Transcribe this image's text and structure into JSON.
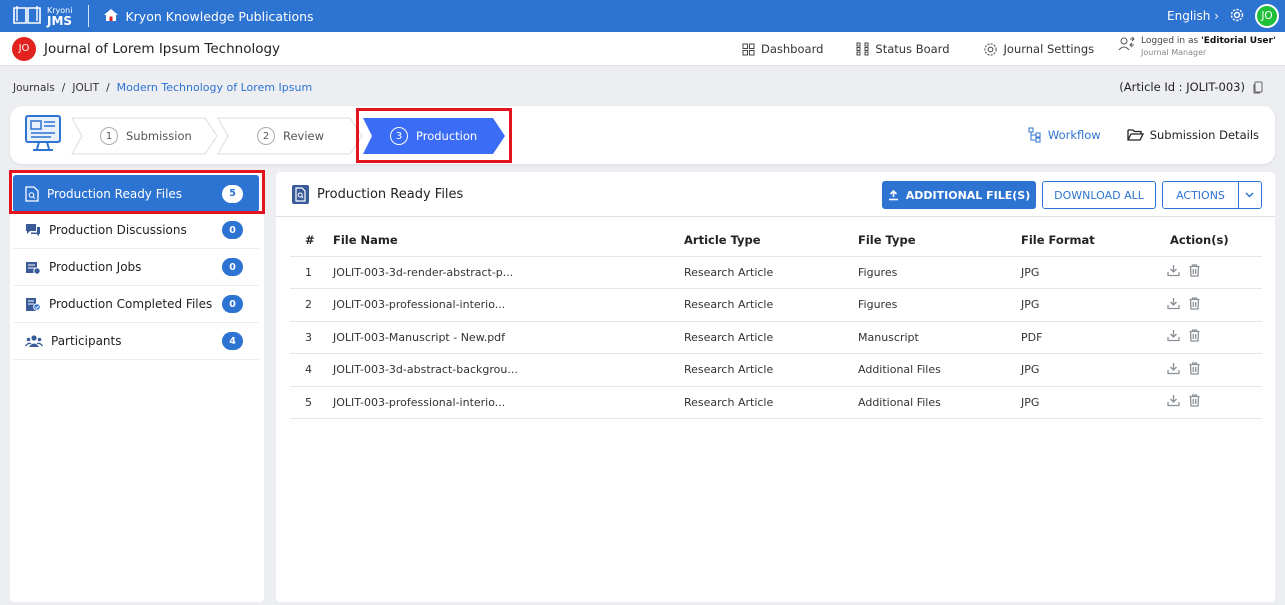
{
  "app": {
    "logo_small": "Kryoni",
    "logo_big": "JMS",
    "publisher": "Kryon Knowledge Publications",
    "language": "English",
    "user_initials": "JO"
  },
  "journal": {
    "initials": "JO",
    "title": "Journal of Lorem Ipsum Technology"
  },
  "nav": {
    "dashboard": "Dashboard",
    "status_board": "Status Board",
    "journal_settings": "Journal Settings",
    "logged_prefix": "Logged in as ",
    "logged_user": "'Editorial User'",
    "role": "Journal Manager"
  },
  "breadcrumb": {
    "root": "Journals",
    "code": "JOLIT",
    "current": "Modern Technology of Lorem Ipsum"
  },
  "article_id": "(Article Id : JOLIT-003)",
  "steps": [
    {
      "num": "1",
      "label": "Submission"
    },
    {
      "num": "2",
      "label": "Review"
    },
    {
      "num": "3",
      "label": "Production"
    }
  ],
  "stepper_links": {
    "workflow": "Workflow",
    "submission_details": "Submission Details"
  },
  "sidebar": [
    {
      "label": "Production Ready Files",
      "count": "5"
    },
    {
      "label": "Production Discussions",
      "count": "0"
    },
    {
      "label": "Production Jobs",
      "count": "0"
    },
    {
      "label": "Production Completed Files",
      "count": "0"
    },
    {
      "label": "Participants",
      "count": "4"
    }
  ],
  "main": {
    "title": "Production Ready Files",
    "btn_additional": "ADDITIONAL FILE(S)",
    "btn_download_all": "DOWNLOAD ALL",
    "btn_actions": "ACTIONS"
  },
  "table": {
    "headers": [
      "#",
      "File Name",
      "Article Type",
      "File Type",
      "File Format",
      "Action(s)"
    ],
    "rows": [
      {
        "num": "1",
        "name": "JOLIT-003-3d-render-abstract-p...",
        "article_type": "Research Article",
        "file_type": "Figures",
        "format": "JPG"
      },
      {
        "num": "2",
        "name": "JOLIT-003-professional-interio...",
        "article_type": "Research Article",
        "file_type": "Figures",
        "format": "JPG"
      },
      {
        "num": "3",
        "name": "JOLIT-003-Manuscript - New.pdf",
        "article_type": "Research Article",
        "file_type": "Manuscript",
        "format": "PDF"
      },
      {
        "num": "4",
        "name": "JOLIT-003-3d-abstract-backgrou...",
        "article_type": "Research Article",
        "file_type": "Additional Files",
        "format": "JPG"
      },
      {
        "num": "5",
        "name": "JOLIT-003-professional-interio...",
        "article_type": "Research Article",
        "file_type": "Additional Files",
        "format": "JPG"
      }
    ]
  },
  "colors": {
    "brand": "#2d73d2",
    "step_active": "#3b6cf5",
    "highlight": "#e3141e",
    "user_badge": "#1fbf3a",
    "journal_badge": "#e1221e"
  }
}
